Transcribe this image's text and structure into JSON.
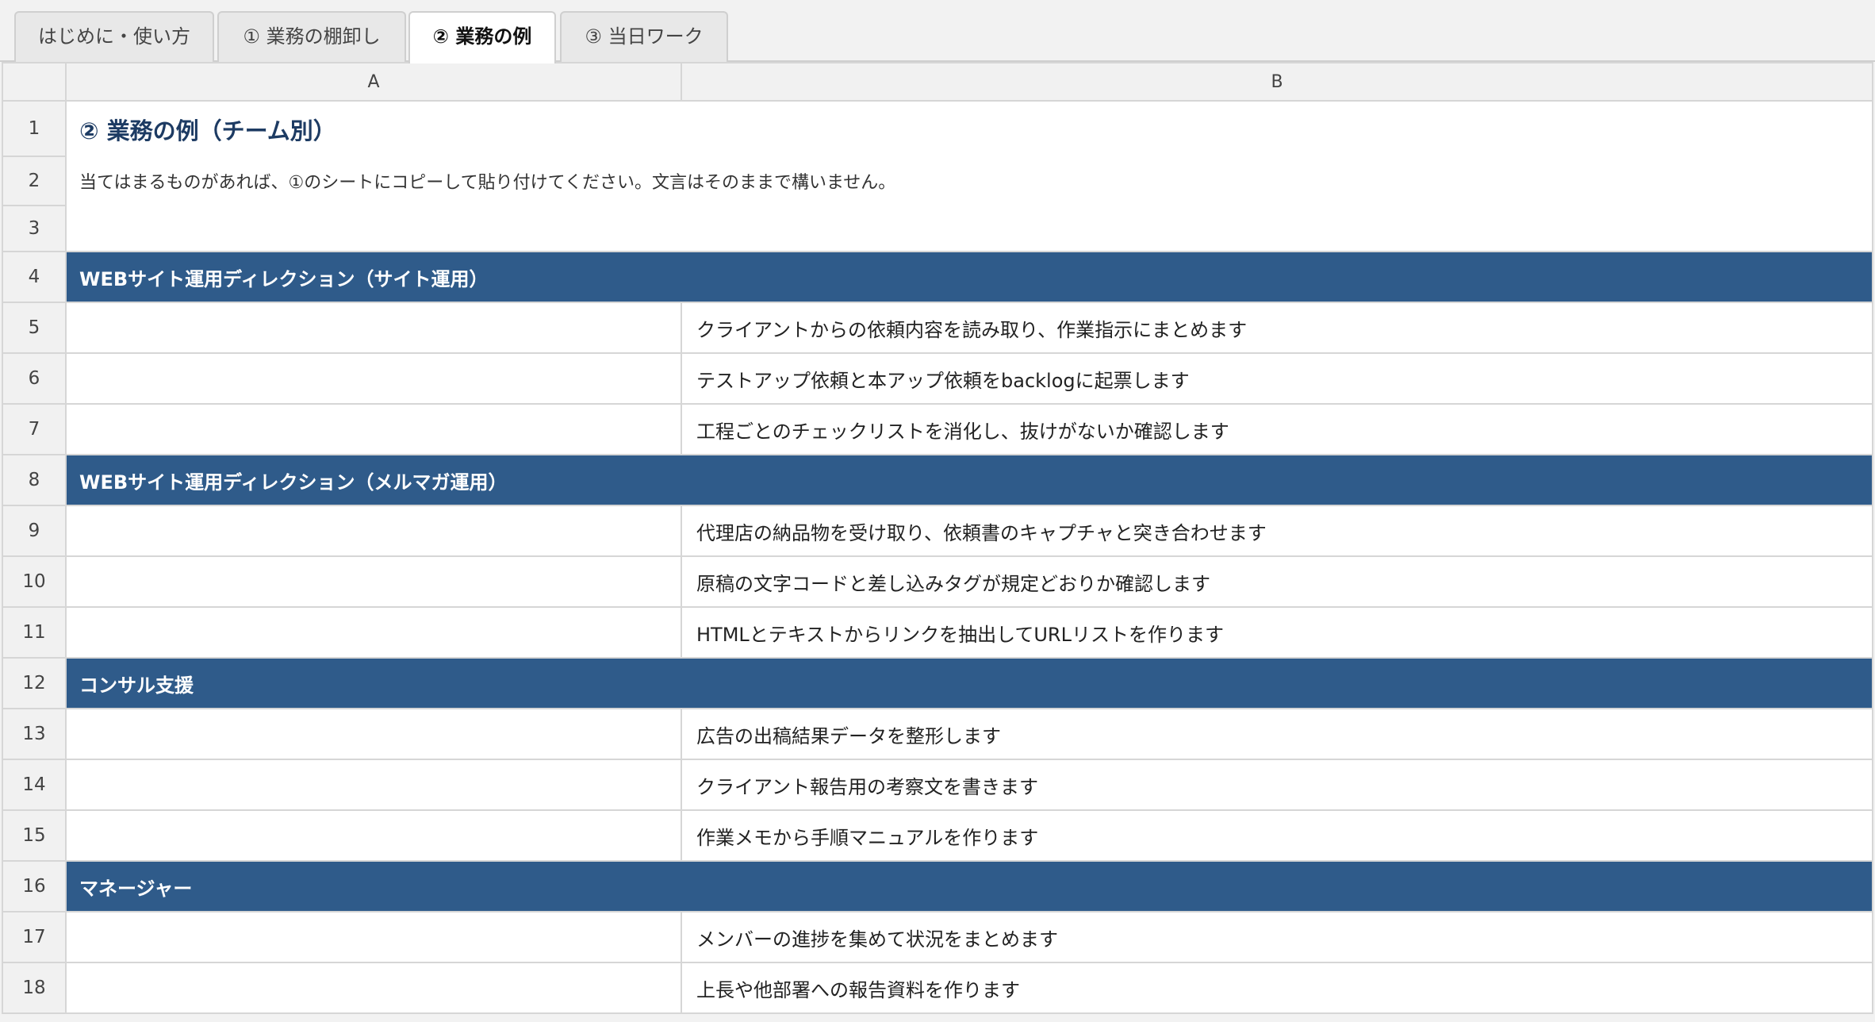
{
  "tabs": [
    {
      "label": "はじめに・使い方",
      "active": false
    },
    {
      "label": "① 業務の棚卸し",
      "active": false
    },
    {
      "label": "② 業務の例",
      "active": true
    },
    {
      "label": "③ 当日ワーク",
      "active": false
    }
  ],
  "columns": [
    "A",
    "B"
  ],
  "rows": [
    {
      "num": "1",
      "type": "title",
      "text": "② 業務の例（チーム別）"
    },
    {
      "num": "2",
      "type": "note",
      "text": "当てはまるものがあれば、①のシートにコピーして貼り付けてください。文言はそのままで構いません。"
    },
    {
      "num": "3",
      "type": "blank"
    },
    {
      "num": "4",
      "type": "section",
      "text": "WEBサイト運用ディレクション（サイト運用）"
    },
    {
      "num": "5",
      "type": "item",
      "a": "",
      "b": "クライアントからの依頼内容を読み取り、作業指示にまとめます"
    },
    {
      "num": "6",
      "type": "item",
      "a": "",
      "b": "テストアップ依頼と本アップ依頼をbacklogに起票します"
    },
    {
      "num": "7",
      "type": "item",
      "a": "",
      "b": "工程ごとのチェックリストを消化し、抜けがないか確認します"
    },
    {
      "num": "8",
      "type": "section",
      "text": "WEBサイト運用ディレクション（メルマガ運用）"
    },
    {
      "num": "9",
      "type": "item",
      "a": "",
      "b": "代理店の納品物を受け取り、依頼書のキャプチャと突き合わせます"
    },
    {
      "num": "10",
      "type": "item",
      "a": "",
      "b": "原稿の文字コードと差し込みタグが規定どおりか確認します"
    },
    {
      "num": "11",
      "type": "item",
      "a": "",
      "b": "HTMLとテキストからリンクを抽出してURLリストを作ります"
    },
    {
      "num": "12",
      "type": "section",
      "text": "コンサル支援"
    },
    {
      "num": "13",
      "type": "item",
      "a": "",
      "b": "広告の出稿結果データを整形します"
    },
    {
      "num": "14",
      "type": "item",
      "a": "",
      "b": "クライアント報告用の考察文を書きます"
    },
    {
      "num": "15",
      "type": "item",
      "a": "",
      "b": "作業メモから手順マニュアルを作ります"
    },
    {
      "num": "16",
      "type": "section",
      "text": "マネージャー"
    },
    {
      "num": "17",
      "type": "item",
      "a": "",
      "b": "メンバーの進捗を集めて状況をまとめます"
    },
    {
      "num": "18",
      "type": "item",
      "a": "",
      "b": "上長や他部署への報告資料を作ります"
    }
  ],
  "colors": {
    "section_bg": "#2f5b8a",
    "title_text": "#1d3b63"
  }
}
